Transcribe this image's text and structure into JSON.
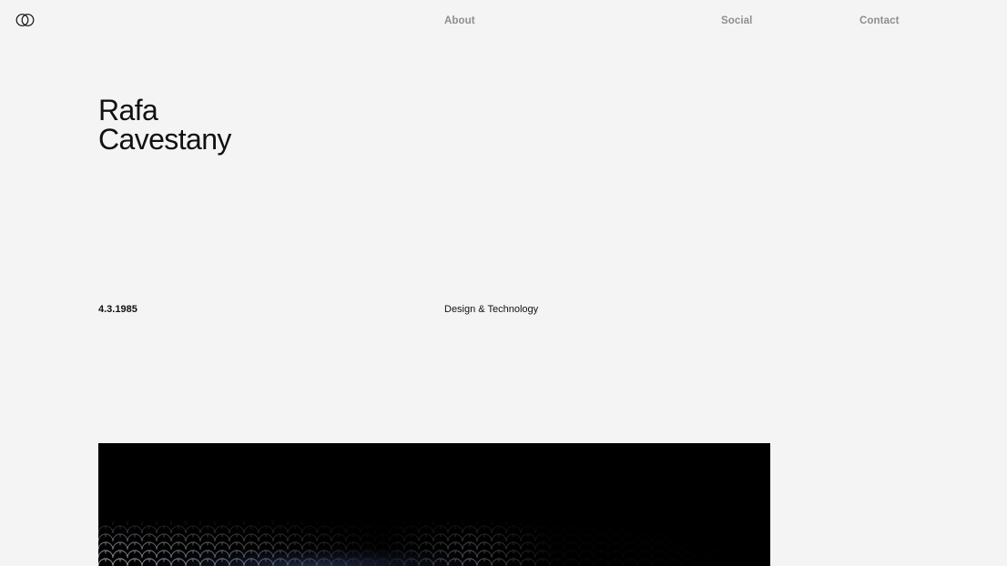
{
  "header": {
    "logo_icon": "interlocking-circles-icon",
    "nav": [
      {
        "label": "About"
      },
      {
        "label": "Social"
      },
      {
        "label": "Contact"
      }
    ]
  },
  "hero": {
    "name_line1": "Rafa",
    "name_line2": "Cavestany"
  },
  "meta": {
    "birthdate": "4.3.1985",
    "discipline": "Design & Technology"
  },
  "media": {
    "icon": "scale-pattern-image"
  },
  "colors": {
    "background": "#f4f4f4",
    "text": "#111111",
    "nav_text": "#8e8e8e",
    "media_background": "#000000"
  }
}
